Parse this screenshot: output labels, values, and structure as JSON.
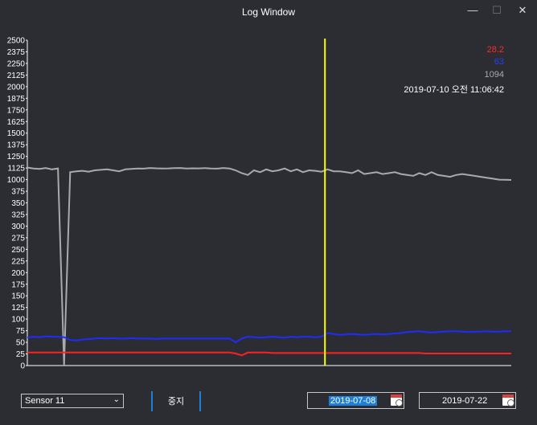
{
  "window": {
    "title": "Log Window",
    "min_glyph": "—",
    "max_glyph": "☐",
    "close_glyph": "✕"
  },
  "chart_data": {
    "type": "line",
    "ylim": [
      0,
      2500
    ],
    "y_ticks": [
      0,
      25,
      50,
      75,
      100,
      125,
      150,
      175,
      200,
      225,
      250,
      275,
      300,
      325,
      350,
      375,
      400,
      425,
      450,
      475,
      500,
      525,
      550,
      575,
      600
    ],
    "y_tick_labels": [
      "0",
      "25",
      "50",
      "75",
      "100",
      "125",
      "150",
      "175",
      "200",
      "225",
      "250",
      "275",
      "300",
      "325",
      "350",
      "375",
      "1000",
      "1125",
      "1250",
      "1375",
      "1500",
      "1625",
      "1750",
      "1875",
      "2000",
      "2125",
      "2250",
      "2375",
      "2500"
    ],
    "cursor_x": 0.615,
    "series": [
      {
        "color": "#aaaaaa",
        "values": [
          1130,
          1120,
          1115,
          1125,
          1110,
          1120,
          0,
          1080,
          1090,
          1095,
          1085,
          1100,
          1105,
          1110,
          1100,
          1090,
          1110,
          1115,
          1120,
          1118,
          1125,
          1122,
          1120,
          1121,
          1123,
          1125,
          1120,
          1122,
          1121,
          1124,
          1120,
          1118,
          1125,
          1120,
          1100,
          1070,
          1050,
          1100,
          1080,
          1110,
          1090,
          1100,
          1120,
          1090,
          1110,
          1080,
          1100,
          1095,
          1085,
          1110,
          1090,
          1090,
          1080,
          1070,
          1100,
          1060,
          1070,
          1080,
          1060,
          1070,
          1080,
          1060,
          1050,
          1040,
          1070,
          1050,
          1080,
          1050,
          1040,
          1030,
          1050,
          1060,
          1050,
          1040,
          1030,
          1020,
          1010,
          1000,
          990,
          980
        ]
      },
      {
        "color": "#1f2bff",
        "values": [
          60,
          62,
          61,
          63,
          62,
          62,
          61,
          55,
          54,
          56,
          57,
          58,
          59,
          58,
          59,
          58,
          58,
          59,
          58,
          58,
          58,
          57,
          58,
          58,
          58,
          58,
          58,
          58,
          58,
          58,
          58,
          58,
          58,
          58,
          50,
          58,
          62,
          61,
          60,
          61,
          62,
          61,
          60,
          62,
          61,
          62,
          62,
          61,
          62,
          70,
          68,
          66,
          67,
          68,
          67,
          66,
          67,
          68,
          67,
          68,
          69,
          70,
          72,
          73,
          74,
          72,
          71,
          72,
          73,
          74,
          74,
          73,
          72,
          73,
          73,
          74,
          73,
          73,
          74,
          74
        ]
      },
      {
        "color": "#ff2020",
        "values": [
          28,
          28,
          28,
          28,
          28,
          28,
          28,
          28,
          28,
          28,
          28,
          28,
          28,
          28,
          28,
          28,
          28,
          28,
          28,
          28,
          28,
          28,
          28,
          28,
          28,
          28,
          28,
          28,
          28,
          28,
          28,
          28,
          28,
          28,
          26,
          22,
          28,
          28,
          28,
          28,
          27,
          27,
          27,
          27,
          27,
          27,
          27,
          27,
          27,
          27,
          27,
          27,
          27,
          27,
          27,
          27,
          27,
          27,
          27,
          27,
          27,
          27,
          27,
          27,
          27,
          26,
          26,
          26,
          26,
          26,
          26,
          26,
          26,
          26,
          26,
          26,
          26,
          26,
          26,
          26
        ]
      }
    ]
  },
  "readouts": {
    "red": "28.2",
    "blue": "63",
    "gray": "1094",
    "time": "2019-07-10 오전 11:06:42"
  },
  "controls": {
    "sensor_select": "Sensor 11",
    "stop_button": "중지",
    "start_date": "2019-07-08",
    "end_date": "2019-07-22"
  }
}
